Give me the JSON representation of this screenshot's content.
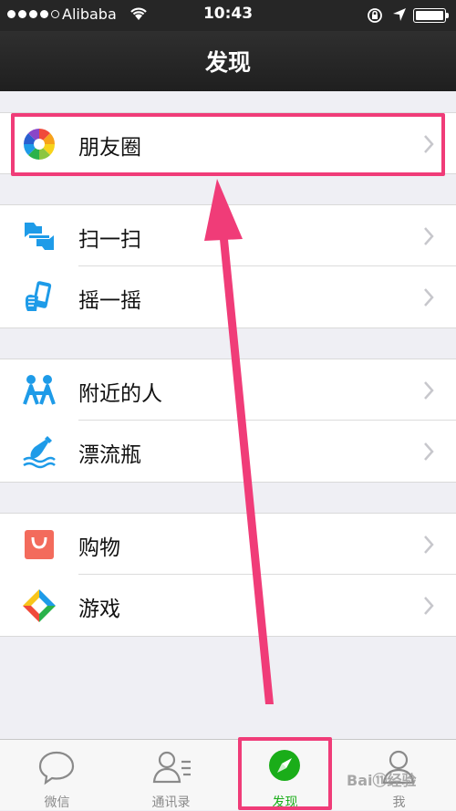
{
  "status_bar": {
    "carrier": "Alibaba",
    "time": "10:43"
  },
  "nav": {
    "title": "发现"
  },
  "menu": {
    "moments": {
      "label": "朋友圈",
      "icon": "moments-icon"
    },
    "scan": {
      "label": "扫一扫",
      "icon": "scan-icon"
    },
    "shake": {
      "label": "摇一摇",
      "icon": "shake-icon"
    },
    "nearby": {
      "label": "附近的人",
      "icon": "nearby-people-icon"
    },
    "bottle": {
      "label": "漂流瓶",
      "icon": "drift-bottle-icon"
    },
    "shopping": {
      "label": "购物",
      "icon": "shopping-bag-icon"
    },
    "games": {
      "label": "游戏",
      "icon": "games-icon"
    }
  },
  "tabs": [
    {
      "label": "微信",
      "icon": "chat-bubble-icon",
      "active": false
    },
    {
      "label": "通讯录",
      "icon": "contacts-icon",
      "active": false
    },
    {
      "label": "发现",
      "icon": "compass-icon",
      "active": true
    },
    {
      "label": "我",
      "icon": "profile-icon",
      "active": false
    }
  ],
  "watermark": "Bai⑪经验",
  "colors": {
    "highlight": "#f03c78",
    "active_tab": "#1aad19",
    "accent_blue": "#1e9be8"
  }
}
